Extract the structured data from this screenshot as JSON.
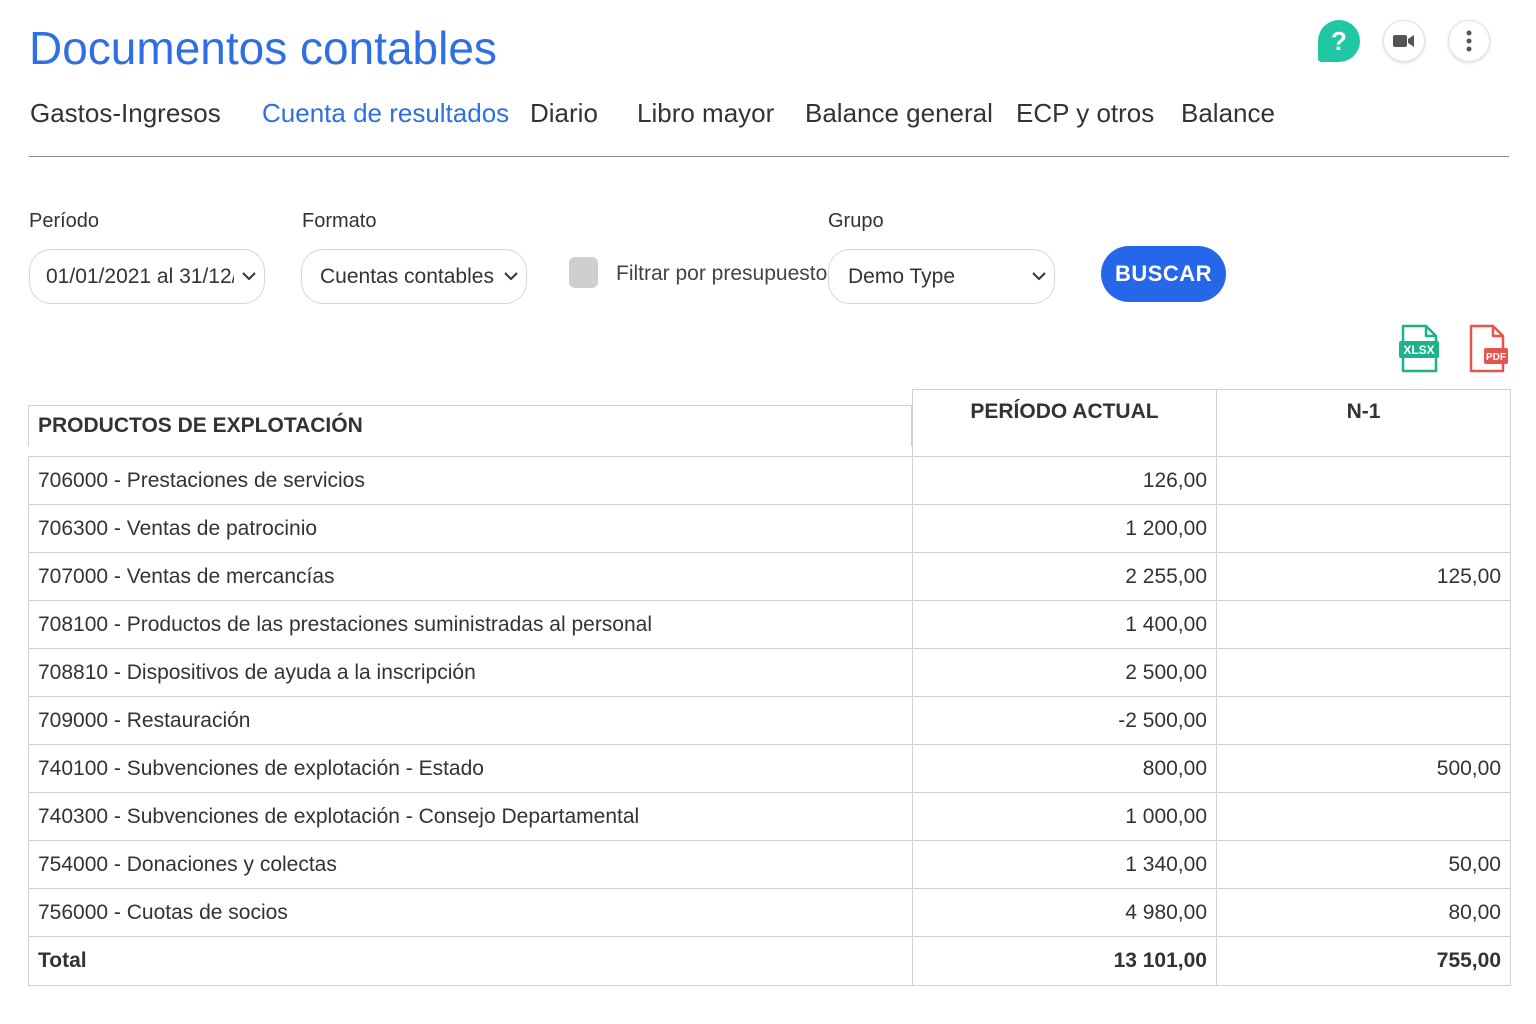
{
  "header": {
    "title": "Documentos contables",
    "help_label": "?"
  },
  "tabs": [
    {
      "label": "Gastos-Ingresos",
      "active": false
    },
    {
      "label": "Cuenta de resultados",
      "active": true
    },
    {
      "label": "Diario",
      "active": false
    },
    {
      "label": "Libro mayor",
      "active": false
    },
    {
      "label": "Balance general",
      "active": false
    },
    {
      "label": "ECP y otros",
      "active": false
    },
    {
      "label": "Balance",
      "active": false
    }
  ],
  "filters": {
    "periodo_label": "Período",
    "periodo_value": "01/01/2021 al 31/12/:",
    "formato_label": "Formato",
    "formato_value": "Cuentas contables",
    "presupuesto_label": "Filtrar por presupuesto",
    "grupo_label": "Grupo",
    "grupo_value": "Demo Type",
    "search_label": "BUSCAR"
  },
  "exports": {
    "xlsx_label": "XLSX",
    "pdf_label": "PDF"
  },
  "table": {
    "section_title": "PRODUCTOS DE EXPLOTACIÓN",
    "col_current": "PERÍODO ACTUAL",
    "col_prev": "N-1",
    "rows": [
      {
        "label": "706000 - Prestaciones de servicios",
        "current": "126,00",
        "prev": ""
      },
      {
        "label": "706300 - Ventas de patrocinio",
        "current": "1 200,00",
        "prev": ""
      },
      {
        "label": "707000 - Ventas de mercancías",
        "current": "2 255,00",
        "prev": "125,00"
      },
      {
        "label": "708100 - Productos de las prestaciones suministradas al personal",
        "current": "1 400,00",
        "prev": ""
      },
      {
        "label": "708810 - Dispositivos de ayuda a la inscripción",
        "current": "2 500,00",
        "prev": ""
      },
      {
        "label": "709000 - Restauración",
        "current": "-2 500,00",
        "prev": ""
      },
      {
        "label": "740100 - Subvenciones de explotación - Estado",
        "current": "800,00",
        "prev": "500,00"
      },
      {
        "label": "740300 - Subvenciones de explotación - Consejo Departamental",
        "current": "1 000,00",
        "prev": ""
      },
      {
        "label": "754000 - Donaciones y colectas",
        "current": "1 340,00",
        "prev": "50,00"
      },
      {
        "label": "756000 - Cuotas de socios",
        "current": "4 980,00",
        "prev": "80,00"
      }
    ],
    "total": {
      "label": "Total",
      "current": "13 101,00",
      "prev": "755,00"
    }
  },
  "colors": {
    "accent": "#2f6fe4",
    "button": "#2567e8",
    "help": "#1fc7a2",
    "xlsx": "#1db38a",
    "pdf": "#e5554f"
  }
}
